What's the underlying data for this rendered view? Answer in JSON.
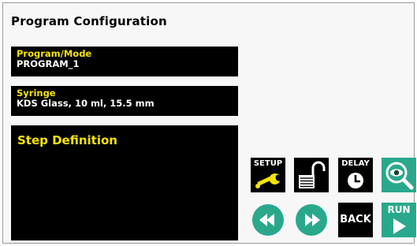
{
  "header": {
    "title": "Program Configuration"
  },
  "program_mode": {
    "label": "Program/Mode",
    "value": "PROGRAM_1"
  },
  "syringe": {
    "label": "Syringe",
    "value": "KDS Glass, 10 ml, 15.5 mm"
  },
  "step_definition": {
    "label": "Step Definition"
  },
  "buttons": {
    "setup": {
      "label": "SETUP",
      "icon": "wrench-icon"
    },
    "lock": {
      "icon": "unlocked-padlock-icon"
    },
    "delay": {
      "label": "DELAY",
      "icon": "clock-icon"
    },
    "view": {
      "icon": "eye-magnifier-icon"
    },
    "rewind": {
      "icon": "rewind-icon"
    },
    "forward": {
      "icon": "fast-forward-icon"
    },
    "back": {
      "label": "BACK"
    },
    "run": {
      "label": "RUN",
      "icon": "play-icon"
    }
  },
  "colors": {
    "field_bg": "#000000",
    "field_label": "#f5e400",
    "field_value": "#ffffff",
    "accent": "#2aa88c",
    "wrench": "#f5e400"
  }
}
